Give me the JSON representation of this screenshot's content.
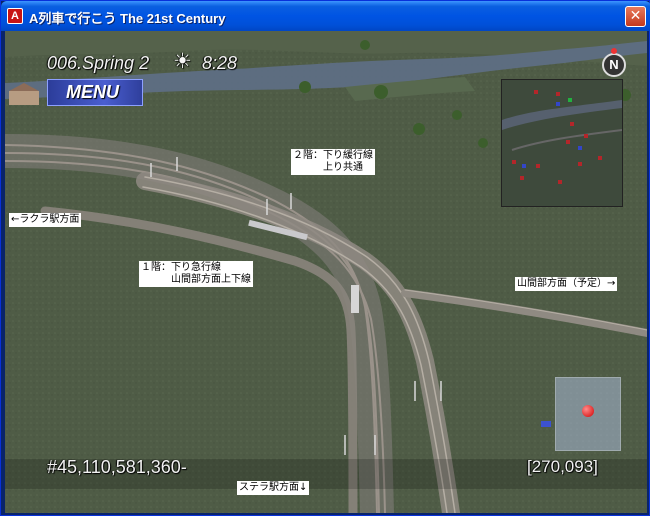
{
  "window": {
    "title": "A列車で行こう The 21st Century",
    "close_glyph": "✕",
    "icon_glyph": "A"
  },
  "hud": {
    "date": "006.Spring  2",
    "sun_glyph": "☀",
    "time": "8:28",
    "menu_label": "MENU",
    "compass_label": "N",
    "money": "#45,110,581,360-",
    "coordinates": "[270,093]"
  },
  "labels": {
    "floor2": "２階：下り緩行線\n　　　上り共通",
    "to_rakura": "←ラクラ駅方面",
    "floor1": "１階：下り急行線\n　　　山間部方面上下線",
    "to_sankanbu": "山間部方面（予定）→",
    "to_sutera": "ステラ駅方面↓"
  },
  "colors": {
    "terrain": "#4d5a44",
    "water": "#5e6f86",
    "title_bar": "#0054e3",
    "rail": "#8a8178"
  }
}
